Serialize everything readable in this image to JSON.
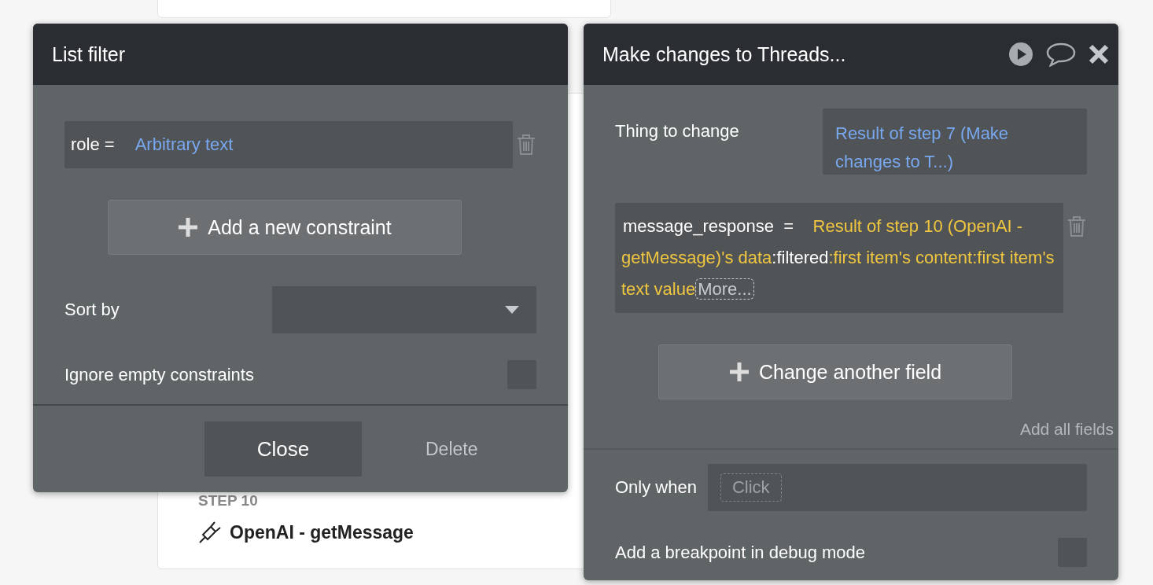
{
  "step": {
    "label": "STEP 10",
    "title": "OpenAI - getMessage"
  },
  "list_filter": {
    "title": "List filter",
    "constraints": [
      {
        "field": "role =",
        "value": "Arbitrary text"
      }
    ],
    "add_button": "Add a new constraint",
    "sort_by": {
      "label": "Sort by"
    },
    "ignore_empty": {
      "label": "Ignore empty constraints",
      "checked": false
    },
    "close_button": "Close",
    "delete_button": "Delete"
  },
  "action": {
    "title": "Make changes to Threads...",
    "thing_to_change": {
      "label": "Thing to change",
      "value": "Result of step 7 (Make changes to T...)"
    },
    "fields": [
      {
        "name": "message_response",
        "operator": "=",
        "parts": [
          {
            "kind": "dynamic",
            "text": "Result of step 10 (OpenAI - getMessage)'s data"
          },
          {
            "kind": "operator",
            "text": ":filtered"
          },
          {
            "kind": "dynamic",
            "text": ":first item's content:first item's text value"
          }
        ],
        "more": "More..."
      }
    ],
    "change_button": "Change another field",
    "add_all": "Add all fields",
    "only_when": {
      "label": "Only when",
      "placeholder": "Click"
    },
    "breakpoint": {
      "label": "Add a breakpoint in debug mode",
      "checked": false
    }
  }
}
